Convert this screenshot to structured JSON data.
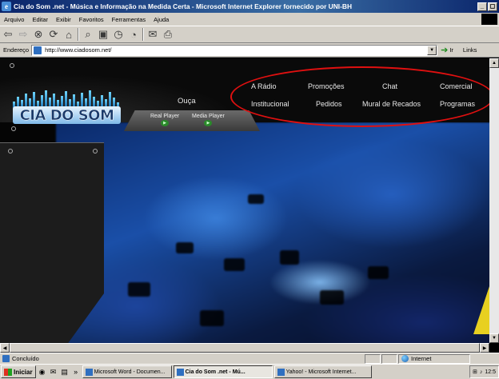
{
  "window": {
    "title": "Cia do Som .net - Música e Informação na Medida Certa - Microsoft Internet Explorer fornecido por UNI-BH",
    "buttons": [
      "_",
      "◻",
      "×"
    ]
  },
  "menu": {
    "items": [
      "Arquivo",
      "Editar",
      "Exibir",
      "Favoritos",
      "Ferramentas",
      "Ajuda"
    ]
  },
  "toolbar": {
    "icons": [
      "back-icon",
      "forward-icon",
      "stop-icon",
      "refresh-icon",
      "home-icon",
      "search-icon",
      "favorites-icon",
      "history-icon",
      "mail-icon",
      "print-icon"
    ]
  },
  "address": {
    "label": "Endereço",
    "url": "http://www.ciadosom.net/",
    "go_label": "Ir",
    "links_label": "Links"
  },
  "site": {
    "logo_text": "CIA DO SOM",
    "listen_label": "Ouça",
    "players": [
      "Real Player",
      "Media Player"
    ],
    "nav": {
      "row1": [
        "A Rádio",
        "Promoções",
        "Chat",
        "Comercial"
      ],
      "row2": [
        "Institucional",
        "Pedidos",
        "Mural de Recados",
        "Programas"
      ]
    },
    "highlight_color": "#e01010"
  },
  "status": {
    "text": "Concluído",
    "zone": "Internet"
  },
  "taskbar": {
    "start_label": "Iniciar",
    "tasks": [
      {
        "label": "Microsoft Word - Documen...",
        "active": false
      },
      {
        "label": "Cia do Som .net - Mú...",
        "active": true
      },
      {
        "label": "Yahoo! - Microsoft Internet...",
        "active": false
      }
    ],
    "clock": "12:5"
  }
}
